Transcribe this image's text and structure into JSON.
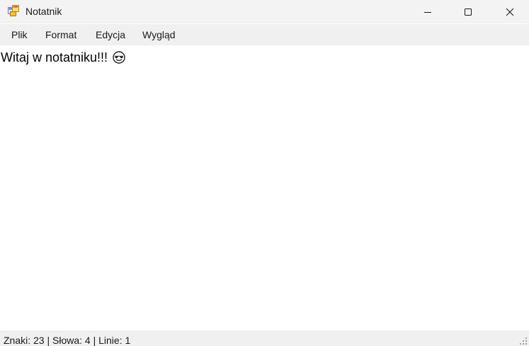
{
  "window": {
    "title": "Notatnik",
    "app_icon": "notepad-app-icon",
    "controls": {
      "minimize_icon": "minimize-icon",
      "maximize_icon": "maximize-icon",
      "close_icon": "close-icon"
    }
  },
  "menu": {
    "items": [
      {
        "label": "Plik"
      },
      {
        "label": "Format"
      },
      {
        "label": "Edycja"
      },
      {
        "label": "Wygląd"
      }
    ]
  },
  "editor": {
    "text": "Witaj w notatniku!!!",
    "emoji_icon": "smiling-face-with-sunglasses-icon"
  },
  "status": {
    "text": "Znaki: 23 | Słowa: 4 | Linie: 1"
  },
  "colors": {
    "titlebar_bg": "#f3f3f3",
    "menubar_bg": "#f0f0f0",
    "editor_bg": "#ffffff",
    "statusbar_bg": "#f0f0f0",
    "text": "#000000"
  }
}
